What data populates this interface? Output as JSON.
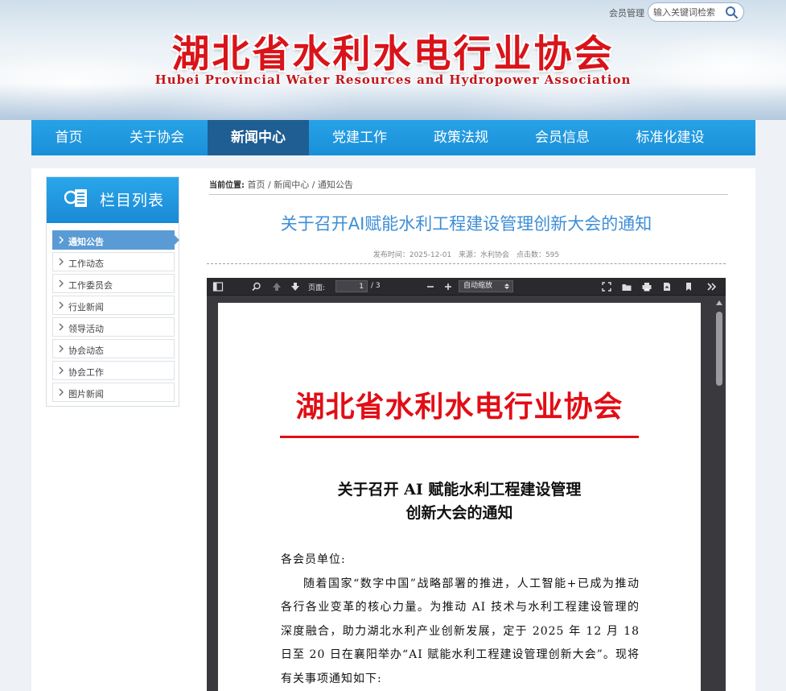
{
  "header": {
    "member_link": "会员管理",
    "search_placeholder": "输入关键词检索",
    "site_title": "湖北省水利水电行业协会",
    "site_subtitle": "Hubei Provincial Water Resources and Hydropower Association"
  },
  "nav": {
    "items": [
      {
        "label": "首页"
      },
      {
        "label": "关于协会"
      },
      {
        "label": "新闻中心"
      },
      {
        "label": "党建工作"
      },
      {
        "label": "政策法规"
      },
      {
        "label": "会员信息"
      },
      {
        "label": "标准化建设"
      }
    ]
  },
  "sidebar": {
    "title": "栏目列表",
    "items": [
      {
        "label": "通知公告"
      },
      {
        "label": "工作动态"
      },
      {
        "label": "工作委员会"
      },
      {
        "label": "行业新闻"
      },
      {
        "label": "领导活动"
      },
      {
        "label": "协会动态"
      },
      {
        "label": "协会工作"
      },
      {
        "label": "图片新闻"
      }
    ]
  },
  "breadcrumb": {
    "label": "当前位置:",
    "path": "首页 / 新闻中心 / 通知公告"
  },
  "article": {
    "title": "关于召开AI赋能水利工程建设管理创新大会的通知",
    "publish_time": "发布时间：2025-12-01",
    "source": "来源：水利协会",
    "clicks": "点击数：595"
  },
  "pdf": {
    "page_label": "页面:",
    "page_current": "1",
    "page_total": "/ 3",
    "zoom": "自动缩放",
    "doc_org": "湖北省水利水电行业协会",
    "doc_title_line1": "关于召开 AI 赋能水利工程建设管理",
    "doc_title_line2": "创新大会的通知",
    "salutation": "各会员单位:",
    "paragraph": "随着国家“数字中国”战略部署的推进，人工智能+已成为推动各行各业变革的核心力量。为推动 AI 技术与水利工程建设管理的深度融合，助力湖北水利产业创新发展，定于 2025 年 12 月 18 日至 20 日在襄阳举办“AI 赋能水利工程建设管理创新大会”。现将有关事项通知如下:"
  },
  "colors": {
    "nav_bg": "#1a8fd9",
    "nav_active": "#1e5e93",
    "title_red": "#d8141a",
    "article_title_blue": "#3d8ed6",
    "sidebar_active": "#5b9bd5"
  }
}
